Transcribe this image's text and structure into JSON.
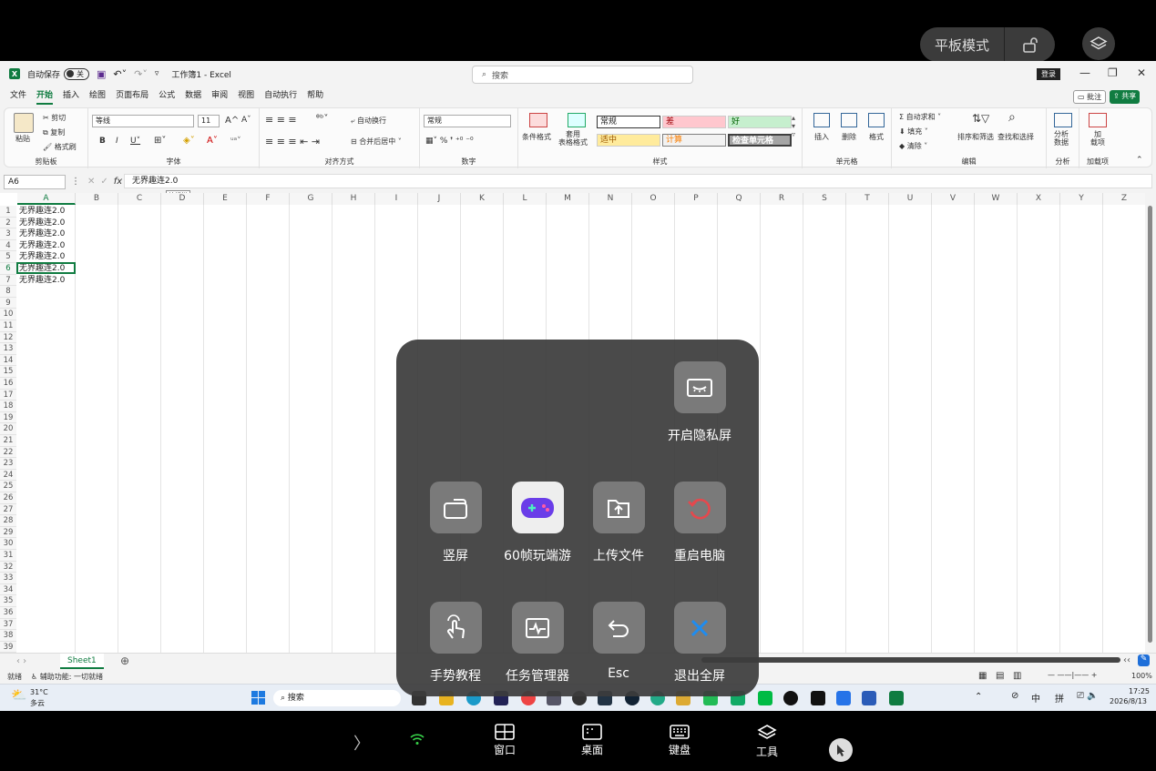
{
  "top": {
    "tablet_mode": "平板模式"
  },
  "excel": {
    "autosave": "自动保存",
    "autosave_state": "关",
    "title": "工作簿1 - Excel",
    "search": "搜索",
    "login": "登录",
    "menu": [
      "文件",
      "开始",
      "插入",
      "绘图",
      "页面布局",
      "公式",
      "数据",
      "审阅",
      "视图",
      "自动执行",
      "帮助"
    ],
    "comment": "批注",
    "share": "共享",
    "ribbon": {
      "paste": "粘贴",
      "cut": "剪切",
      "copy": "复制",
      "format_painter": "格式刷",
      "clipboard": "剪贴板",
      "font_name": "等线",
      "font_size": "11",
      "font_group": "字体",
      "wrap": "自动换行",
      "merge": "合并后居中",
      "align_group": "对齐方式",
      "number_format": "常规",
      "number_group": "数字",
      "cond_format": "条件格式",
      "table_format": "套用\n表格格式",
      "styles": [
        "常规",
        "差",
        "好",
        "适中",
        "计算",
        "检查单元格"
      ],
      "style_group": "样式",
      "insert": "插入",
      "delete": "删除",
      "format": "格式",
      "cells_group": "单元格",
      "autosum": "自动求和",
      "fill": "填充",
      "clear": "清除",
      "sort": "排序和筛选",
      "find": "查找和选择",
      "edit_group": "编辑",
      "analyze": "分析\n数据",
      "analysis_group": "分析",
      "addins": "加\n载项",
      "addins_group": "加载项"
    },
    "namebox": "A6",
    "formula": "无界趣连2.0",
    "tooltip": "编辑栏",
    "columns": [
      "A",
      "B",
      "C",
      "D",
      "E",
      "F",
      "G",
      "H",
      "I",
      "J",
      "K",
      "L",
      "M",
      "N",
      "O",
      "P",
      "Q",
      "R",
      "S",
      "T",
      "U",
      "V",
      "W",
      "X",
      "Y",
      "Z"
    ],
    "rows": [
      "1",
      "2",
      "3",
      "4",
      "5",
      "6",
      "7",
      "8",
      "9",
      "10",
      "11",
      "12",
      "13",
      "14",
      "15",
      "16",
      "17",
      "18",
      "19",
      "20",
      "21",
      "22",
      "23",
      "24",
      "25",
      "26",
      "27",
      "28",
      "29",
      "30",
      "31",
      "32",
      "33",
      "34",
      "35",
      "36",
      "37",
      "38",
      "39"
    ],
    "cells": [
      "无界趣连2.0",
      "无界趣连2.0",
      "无界趣连2.0",
      "无界趣连2.0",
      "无界趣连2.0",
      "无界趣连2.0",
      "无界趣连2.0"
    ],
    "sheet_tab": "Sheet1",
    "status": "就绪",
    "accessibility": "辅助功能: 一切就绪",
    "zoom": "100%"
  },
  "taskbar": {
    "temp": "31°C",
    "weather": "多云",
    "search": "搜索",
    "ime1": "中",
    "ime2": "拼",
    "time": "17:25",
    "date": "2026/8/13"
  },
  "overlay": {
    "privacy": "开启隐私屏",
    "portrait": "竖屏",
    "game": "60帧玩端游",
    "upload": "上传文件",
    "restart": "重启电脑",
    "gesture": "手势教程",
    "taskmgr": "任务管理器",
    "esc": "Esc",
    "exit": "退出全屏"
  },
  "bottom": {
    "window": "窗口",
    "desktop": "桌面",
    "keyboard": "键盘",
    "tools": "工具"
  },
  "colors": {
    "excel_green": "#107c41",
    "overlay_bg": "#3c3c3c",
    "restart_red": "#e5484d",
    "exit_blue": "#1e8cf0",
    "game_purple": "#6a3de8"
  }
}
